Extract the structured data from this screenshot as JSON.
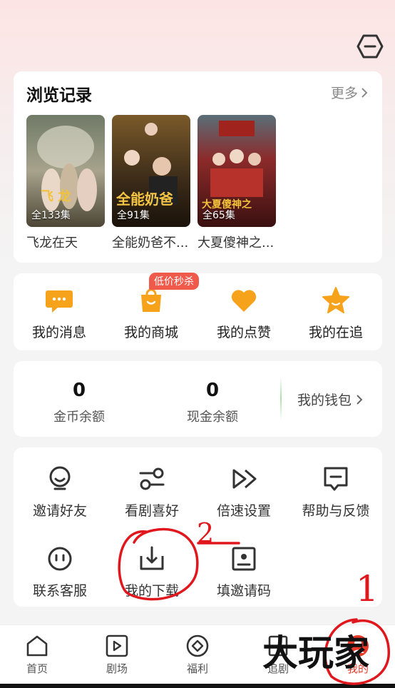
{
  "history": {
    "title": "浏览记录",
    "more_label": "更多",
    "items": [
      {
        "episodes": "全133集",
        "name": "飞龙在天"
      },
      {
        "episodes": "全91集",
        "name": "全能奶爸不..."
      },
      {
        "episodes": "全65集",
        "name": "大夏傻神之..."
      }
    ]
  },
  "quick_actions": {
    "badge": "低价秒杀",
    "items": [
      {
        "label": "我的消息",
        "icon": "message-icon"
      },
      {
        "label": "我的商城",
        "icon": "shopping-bag-icon"
      },
      {
        "label": "我的点赞",
        "icon": "heart-icon"
      },
      {
        "label": "我的在追",
        "icon": "star-icon"
      }
    ]
  },
  "wallet": {
    "coins_value": "0",
    "coins_label": "金币余额",
    "cash_value": "0",
    "cash_label": "现金余额",
    "wallet_label": "我的钱包"
  },
  "tools": {
    "items": [
      {
        "label": "邀请好友",
        "icon": "invite-icon"
      },
      {
        "label": "看剧喜好",
        "icon": "preference-icon"
      },
      {
        "label": "倍速设置",
        "icon": "speed-icon"
      },
      {
        "label": "帮助与反馈",
        "icon": "help-icon"
      },
      {
        "label": "联系客服",
        "icon": "service-icon"
      },
      {
        "label": "我的下载",
        "icon": "download-icon"
      },
      {
        "label": "填邀请码",
        "icon": "invite-code-icon"
      }
    ]
  },
  "tabbar": {
    "items": [
      {
        "label": "首页",
        "icon": "home-icon"
      },
      {
        "label": "剧场",
        "icon": "theater-icon"
      },
      {
        "label": "福利",
        "icon": "welfare-icon"
      },
      {
        "label": "追剧",
        "icon": "follow-icon"
      },
      {
        "label": "我的",
        "icon": "profile-icon"
      }
    ],
    "active": "我的"
  },
  "annotations": {
    "mark_1": "1",
    "mark_2": "2",
    "watermark": "大玩家"
  },
  "colors": {
    "accent_orange": "#f7a21b",
    "badge_red": "#f05a4b",
    "active_tab": "#e8392b"
  }
}
